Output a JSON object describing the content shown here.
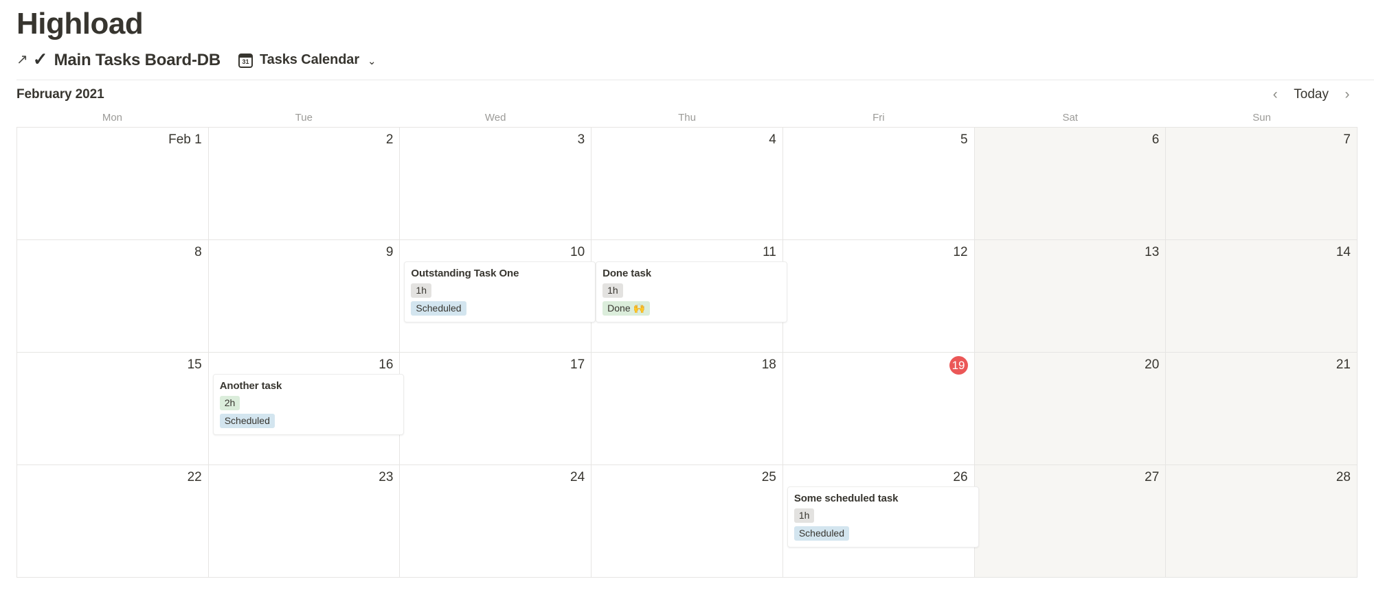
{
  "page": {
    "title": "Highload"
  },
  "breadcrumb": {
    "open_icon": "arrow-up-right-icon",
    "db_icon": "check-icon",
    "db_name": "Main Tasks Board-DB",
    "view_icon": "calendar-icon",
    "view_icon_label": "31",
    "view_name": "Tasks Calendar",
    "chevron_icon": "chevron-down-icon"
  },
  "toolbar": {
    "month_label": "February 2021",
    "prev_label": "‹",
    "today_label": "Today",
    "next_label": "›"
  },
  "weekdays": [
    "Mon",
    "Tue",
    "Wed",
    "Thu",
    "Fri",
    "Sat",
    "Sun"
  ],
  "colors": {
    "today_badge": "#eb5757",
    "weekend_bg": "#f7f6f3",
    "grid_line": "#e6e5e3",
    "chip_gray": "#e3e2e0",
    "chip_green": "#dbeddb",
    "chip_blue": "#d3e5ef"
  },
  "weeks": [
    [
      {
        "label": "Feb 1",
        "weekend": false,
        "today": false,
        "events": []
      },
      {
        "label": "2",
        "weekend": false,
        "today": false,
        "events": []
      },
      {
        "label": "3",
        "weekend": false,
        "today": false,
        "events": []
      },
      {
        "label": "4",
        "weekend": false,
        "today": false,
        "events": []
      },
      {
        "label": "5",
        "weekend": false,
        "today": false,
        "events": []
      },
      {
        "label": "6",
        "weekend": true,
        "today": false,
        "events": []
      },
      {
        "label": "7",
        "weekend": true,
        "today": false,
        "events": []
      }
    ],
    [
      {
        "label": "8",
        "weekend": false,
        "today": false,
        "events": []
      },
      {
        "label": "9",
        "weekend": false,
        "today": false,
        "events": []
      },
      {
        "label": "10",
        "weekend": false,
        "today": false,
        "events": [
          {
            "title": "Outstanding Task One",
            "duration": "1h",
            "duration_color": "gray",
            "status": "Scheduled",
            "status_color": "blue"
          }
        ]
      },
      {
        "label": "11",
        "weekend": false,
        "today": false,
        "events": [
          {
            "title": "Done task",
            "duration": "1h",
            "duration_color": "gray",
            "status": "Done 🙌",
            "status_color": "green"
          }
        ]
      },
      {
        "label": "12",
        "weekend": false,
        "today": false,
        "events": []
      },
      {
        "label": "13",
        "weekend": true,
        "today": false,
        "events": []
      },
      {
        "label": "14",
        "weekend": true,
        "today": false,
        "events": []
      }
    ],
    [
      {
        "label": "15",
        "weekend": false,
        "today": false,
        "events": []
      },
      {
        "label": "16",
        "weekend": false,
        "today": false,
        "events": [
          {
            "title": "Another task",
            "duration": "2h",
            "duration_color": "green",
            "status": "Scheduled",
            "status_color": "blue"
          }
        ]
      },
      {
        "label": "17",
        "weekend": false,
        "today": false,
        "events": []
      },
      {
        "label": "18",
        "weekend": false,
        "today": false,
        "events": []
      },
      {
        "label": "19",
        "weekend": false,
        "today": true,
        "events": []
      },
      {
        "label": "20",
        "weekend": true,
        "today": false,
        "events": []
      },
      {
        "label": "21",
        "weekend": true,
        "today": false,
        "events": []
      }
    ],
    [
      {
        "label": "22",
        "weekend": false,
        "today": false,
        "events": []
      },
      {
        "label": "23",
        "weekend": false,
        "today": false,
        "events": []
      },
      {
        "label": "24",
        "weekend": false,
        "today": false,
        "events": []
      },
      {
        "label": "25",
        "weekend": false,
        "today": false,
        "events": []
      },
      {
        "label": "26",
        "weekend": false,
        "today": false,
        "events": [
          {
            "title": "Some scheduled task",
            "duration": "1h",
            "duration_color": "gray",
            "status": "Scheduled",
            "status_color": "blue"
          }
        ]
      },
      {
        "label": "27",
        "weekend": true,
        "today": false,
        "events": []
      },
      {
        "label": "28",
        "weekend": true,
        "today": false,
        "events": []
      }
    ]
  ]
}
